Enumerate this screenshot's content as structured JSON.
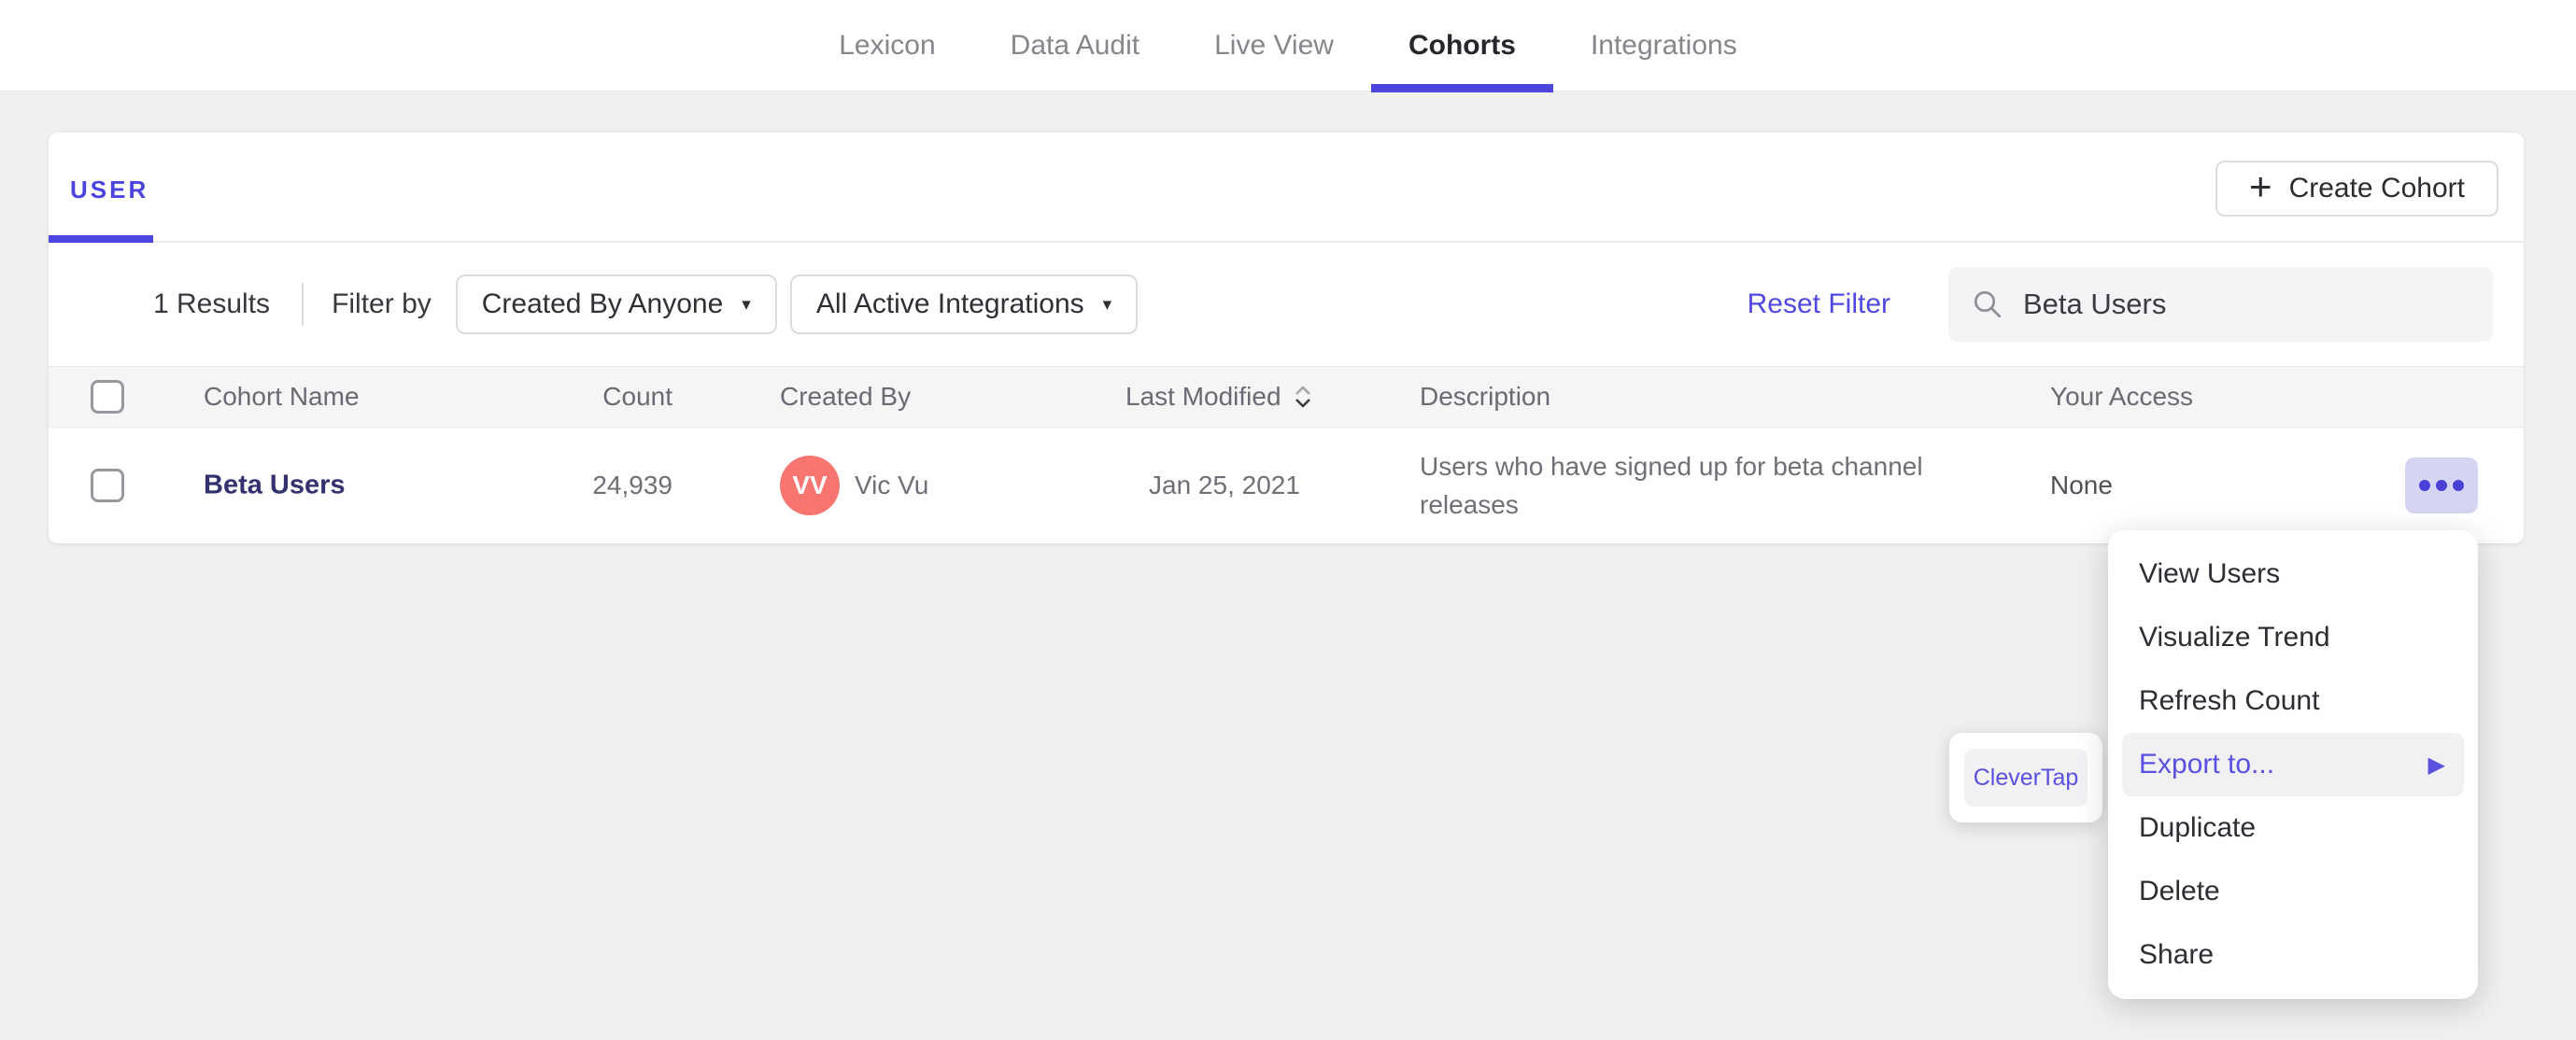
{
  "nav": {
    "items": [
      {
        "label": "Lexicon"
      },
      {
        "label": "Data Audit"
      },
      {
        "label": "Live View"
      },
      {
        "label": "Cohorts"
      },
      {
        "label": "Integrations"
      }
    ],
    "active": "Cohorts"
  },
  "tabs": {
    "user_label": "USER"
  },
  "toolbar": {
    "create_cohort_label": "Create Cohort",
    "plus_icon": "+"
  },
  "filterbar": {
    "results_count": "1 Results",
    "filter_by_label": "Filter by",
    "created_by_dropdown": "Created By Anyone",
    "integrations_dropdown": "All Active Integrations",
    "reset_filter_label": "Reset Filter",
    "search": {
      "value": "Beta Users"
    }
  },
  "icons": {
    "caret_down": "▾",
    "arrow_right": "▶"
  },
  "table": {
    "headers": {
      "name": "Cohort Name",
      "count": "Count",
      "created_by": "Created By",
      "last_modified": "Last Modified",
      "description": "Description",
      "your_access": "Your Access"
    },
    "row": {
      "name": "Beta Users",
      "count": "24,939",
      "created_by_initials": "VV",
      "created_by_name": "Vic Vu",
      "last_modified": "Jan 25, 2021",
      "description": "Users who have signed up for beta channel releases",
      "your_access": "None"
    }
  },
  "context_menu": {
    "items": [
      "View Users",
      "Visualize Trend",
      "Refresh Count",
      "Export to...",
      "Duplicate",
      "Delete",
      "Share"
    ],
    "highlighted": "Export to..."
  },
  "submenu": {
    "clevertap_label": "CleverTap"
  },
  "colors": {
    "accent": "#4b44df",
    "link_purple": "#5a50e2",
    "row_link": "#343170",
    "avatar": "#f8766f"
  }
}
